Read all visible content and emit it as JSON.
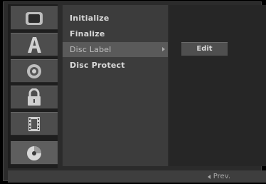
{
  "sidebar": {
    "icons": [
      {
        "name": "monitor-icon"
      },
      {
        "name": "language-a-icon"
      },
      {
        "name": "speaker-icon"
      },
      {
        "name": "lock-icon"
      },
      {
        "name": "film-icon"
      },
      {
        "name": "disc-icon",
        "active": true
      }
    ]
  },
  "menu": {
    "items": [
      {
        "label": "Initialize"
      },
      {
        "label": "Finalize"
      },
      {
        "label": "Disc Label",
        "selected": true
      },
      {
        "label": "Disc Protect"
      }
    ]
  },
  "submenu": {
    "edit_label": "Edit"
  },
  "footer": {
    "prev_label": "Prev."
  },
  "colors": {
    "background": "#000000",
    "panel": "#3c3c3c",
    "subpanel": "#262626",
    "highlight": "#5a5a5a",
    "text": "#d8d8d8"
  }
}
